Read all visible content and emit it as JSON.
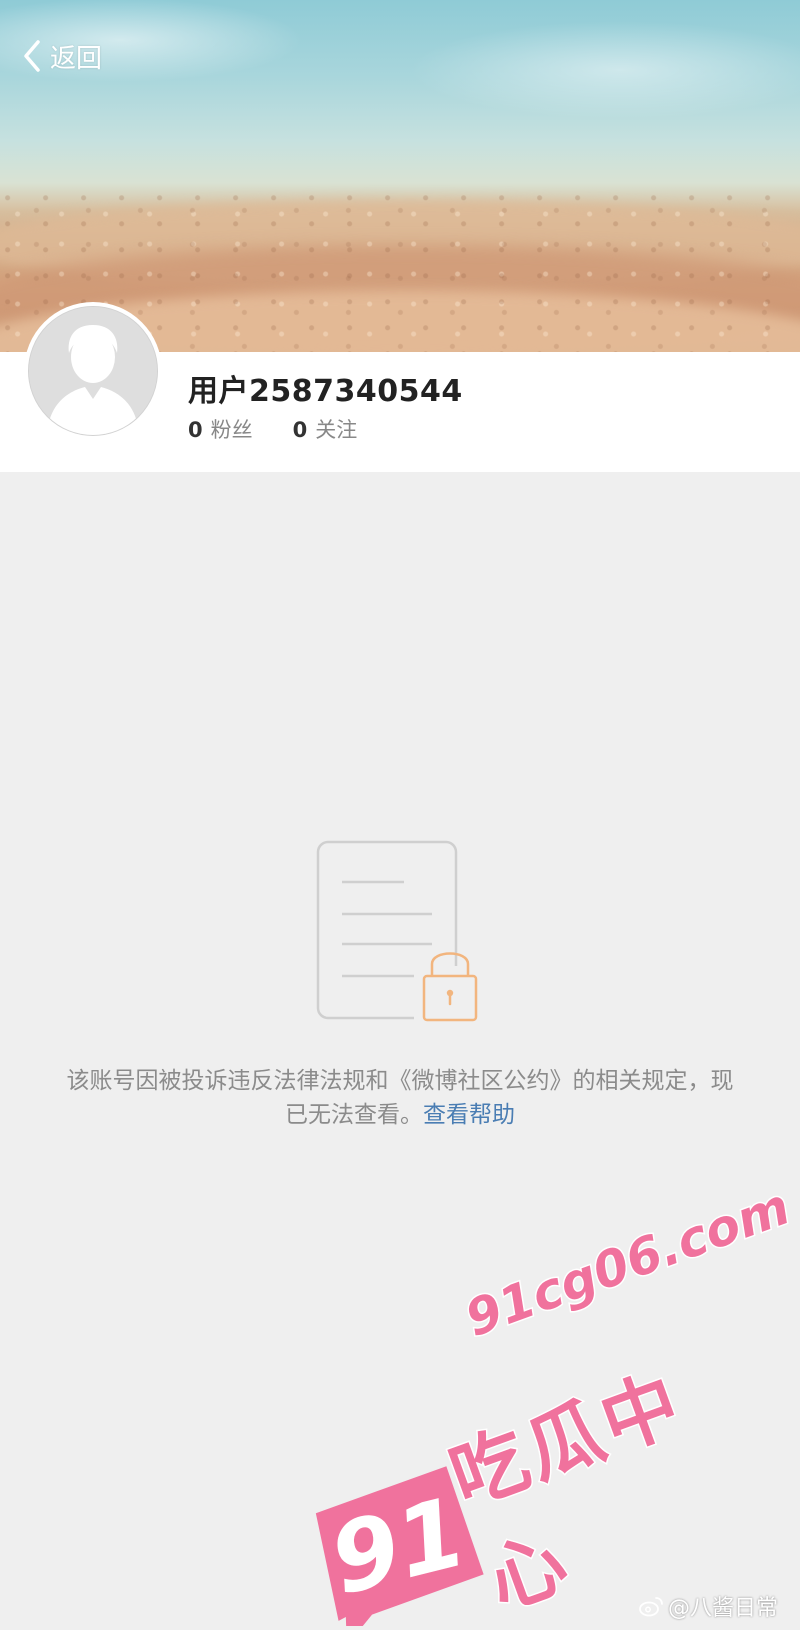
{
  "nav": {
    "back_label": "返回"
  },
  "profile": {
    "username": "用户2587340544",
    "fans_count": "0",
    "fans_label": "粉丝",
    "following_count": "0",
    "following_label": "关注"
  },
  "notice": {
    "text": "该账号因被投诉违反法律法规和《微博社区公约》的相关规定，现已无法查看。",
    "help_link": "查看帮助"
  },
  "watermark": {
    "site": "91cg06.com",
    "brand_cn": "吃瓜中心",
    "badge_number": "91",
    "weibo_handle": "@八酱日常"
  },
  "icons": {
    "back": "chevron-left-icon",
    "avatar": "default-avatar-icon",
    "locked_document": "locked-document-icon",
    "weibo": "weibo-icon"
  },
  "colors": {
    "link": "#4a7db3",
    "lock_accent": "#f2b57e",
    "watermark_pink": "#f0729d",
    "page_background": "#efefef"
  }
}
